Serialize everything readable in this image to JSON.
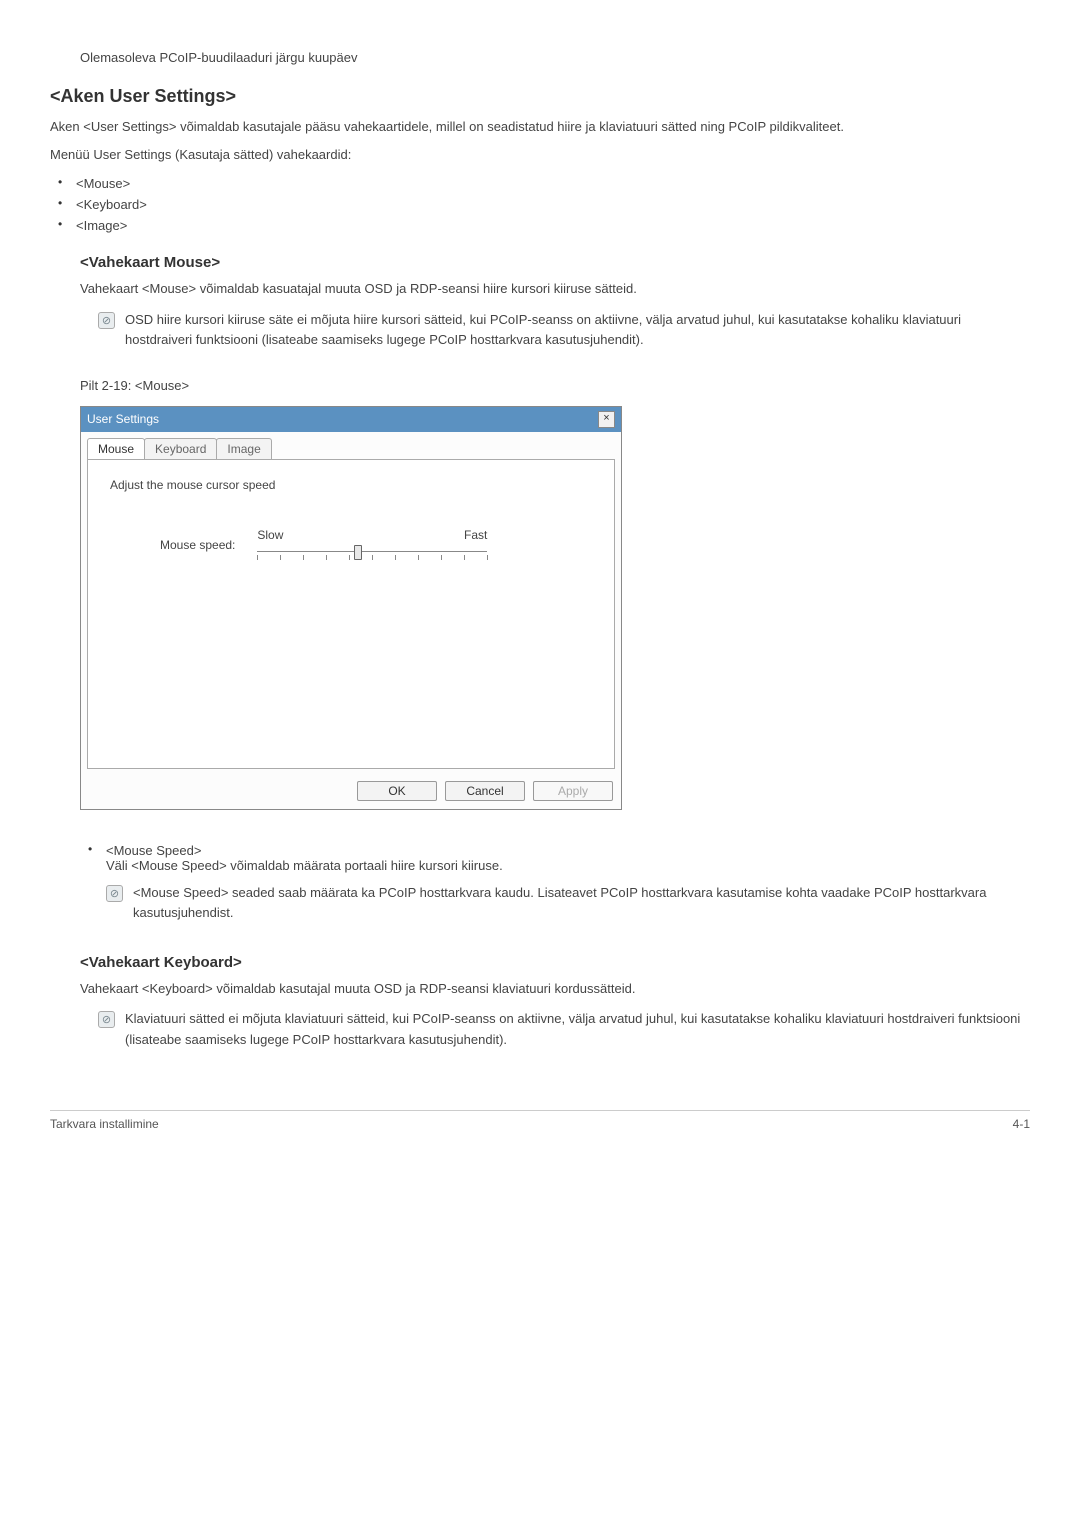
{
  "topnote": "Olemasoleva PCoIP-buudilaaduri järgu kuupäev",
  "heading_main": "<Aken User Settings>",
  "intro": "Aken <User Settings> võimaldab kasutajale pääsu vahekaartidele, millel on seadistatud hiire ja klaviatuuri sätted ning PCoIP pildikvaliteet.",
  "menu_intro": "Menüü User Settings (Kasutaja sätted) vahekaardid:",
  "menu_items": {
    "0": "<Mouse>",
    "1": "<Keyboard>",
    "2": "<Image>"
  },
  "mouse": {
    "heading": "<Vahekaart Mouse>",
    "desc": "Vahekaart <Mouse> võimaldab kasuatajal muuta OSD ja RDP-seansi hiire kursori kiiruse sätteid.",
    "note": "OSD hiire kursori kiiruse säte ei mõjuta hiire kursori sätteid, kui PCoIP-seanss on aktiivne, välja arvatud juhul, kui kasutatakse kohaliku klaviatuuri hostdraiveri funktsiooni (lisateabe saamiseks lugege PCoIP hosttarkvara kasutusjuhendit).",
    "fig_caption": "Pilt 2-19: <Mouse>",
    "dialog": {
      "title": "User Settings",
      "tabs": {
        "0": "Mouse",
        "1": "Keyboard",
        "2": "Image"
      },
      "instruction": "Adjust the mouse cursor speed",
      "slider_label": "Mouse speed:",
      "slow": "Slow",
      "fast": "Fast",
      "ok": "OK",
      "cancel": "Cancel",
      "apply": "Apply"
    },
    "speed": {
      "label": "<Mouse Speed>",
      "desc": "Väli <Mouse Speed> võimaldab määrata portaali hiire kursori kiiruse.",
      "note": "<Mouse Speed> seaded saab määrata ka PCoIP hosttarkvara kaudu. Lisateavet PCoIP hosttarkvara kasutamise kohta vaadake PCoIP hosttarkvara kasutusjuhendist."
    }
  },
  "keyboard": {
    "heading": "<Vahekaart Keyboard>",
    "desc": "Vahekaart <Keyboard> võimaldab kasutajal muuta OSD ja RDP-seansi klaviatuuri kordussätteid.",
    "note": "Klaviatuuri sätted ei mõjuta klaviatuuri sätteid, kui PCoIP-seanss on aktiivne, välja arvatud juhul, kui kasutatakse kohaliku klaviatuuri hostdraiveri funktsiooni (lisateabe saamiseks lugege PCoIP hosttarkvara kasutusjuhendit)."
  },
  "footer": {
    "left": "Tarkvara installimine",
    "right": "4-1"
  },
  "icons": {
    "info": "⊘",
    "close": "×"
  }
}
